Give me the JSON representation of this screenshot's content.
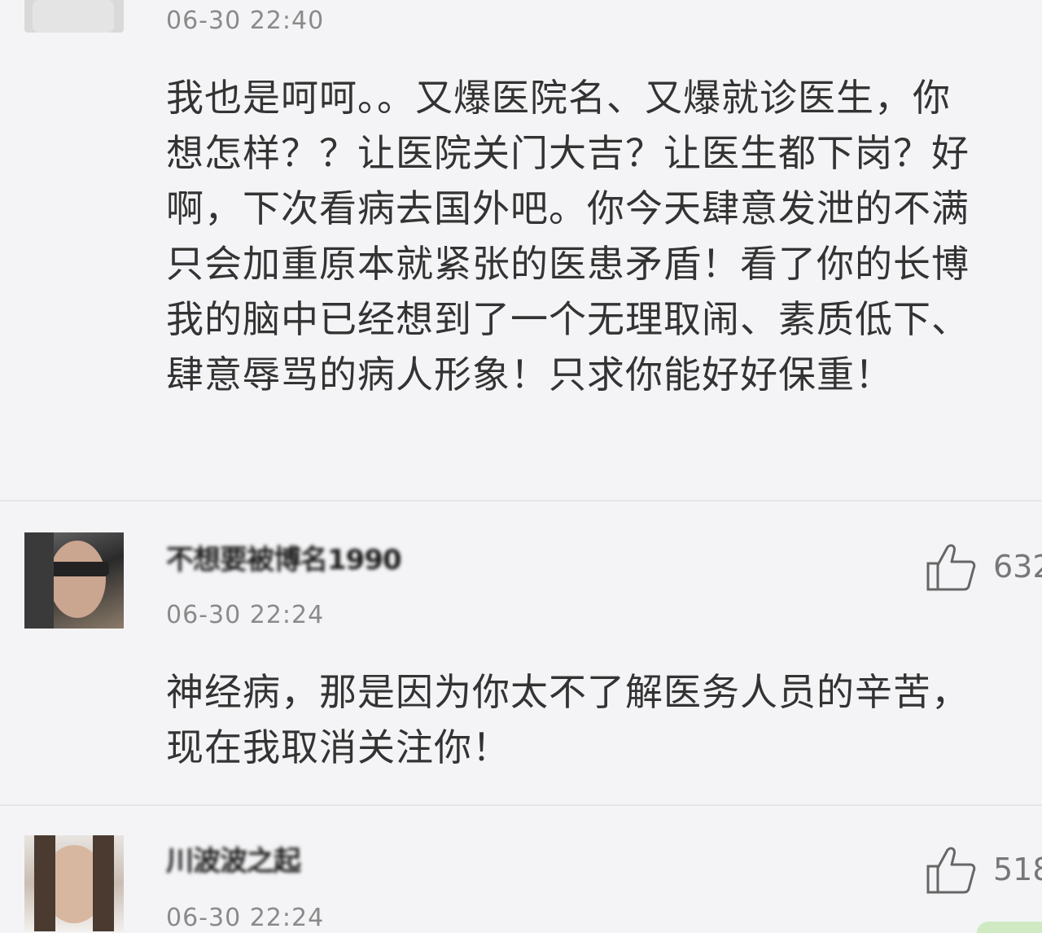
{
  "comments": [
    {
      "timestamp": "06-30 22:40",
      "text": "我也是呵呵。。又爆医院名、又爆就诊医生，你想怎样？？让医院关门大吉？让医生都下岗？好啊，下次看病去国外吧。你今天肆意发泄的不满只会加重原本就紧张的医患矛盾！看了你的长博我的脑中已经想到了一个无理取闹、素质低下、肆意辱骂的病人形象！只求你能好好保重！"
    },
    {
      "username": "不想要被博名1990",
      "timestamp": "06-30 22:24",
      "likes": "632",
      "text": "神经病，那是因为你太不了解医务人员的辛苦，现在我取消关注你！"
    },
    {
      "username": "川波波之起",
      "timestamp": "06-30 22:24",
      "likes": "518"
    }
  ],
  "icons": {
    "like": "thumbs-up-icon"
  },
  "colors": {
    "background": "#f4f4f6",
    "text": "#333333",
    "timestamp": "#8a8a8a",
    "divider": "#e6e6e8"
  }
}
